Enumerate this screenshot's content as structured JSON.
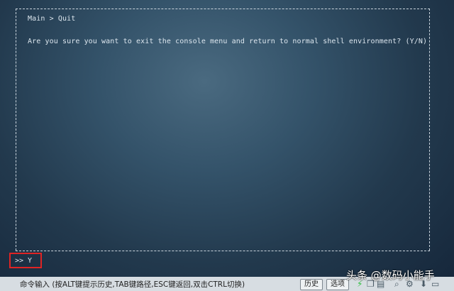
{
  "terminal": {
    "breadcrumb": "Main > Quit",
    "question": "Are you sure you want to exit the console menu and return to normal shell environment? (Y/N)",
    "input_prompt": ">> Y"
  },
  "statusbar": {
    "hint": "命令输入 (按ALT键提示历史,TAB键路径,ESC键返回,双击CTRL切换)",
    "history_label": "历史",
    "options_label": "选项",
    "icons": [
      "lightning-icon",
      "copy-icon",
      "layers-icon",
      "search-icon",
      "settings-icon",
      "download-icon",
      "window-icon"
    ]
  },
  "watermark": {
    "text": "头条 @数码小能手"
  },
  "colors": {
    "highlight_box": "#e02424",
    "lightning": "#2fbf3f",
    "statusbar_bg": "#d7dde2"
  }
}
